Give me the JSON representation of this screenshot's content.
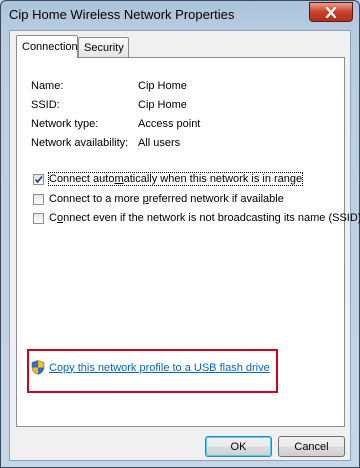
{
  "window": {
    "title": "Cip Home Wireless Network Properties"
  },
  "tabs": [
    {
      "label": "Connection",
      "active": true
    },
    {
      "label": "Security",
      "active": false
    }
  ],
  "info": [
    {
      "label": "Name:",
      "value": "Cip Home"
    },
    {
      "label": "SSID:",
      "value": "Cip Home"
    },
    {
      "label": "Network type:",
      "value": "Access point"
    },
    {
      "label": "Network availability:",
      "value": "All users"
    }
  ],
  "options": [
    {
      "pre": "Connect auto",
      "key": "m",
      "post": "atically when this network is in range",
      "checked": true
    },
    {
      "pre": "Connect to a more ",
      "key": "p",
      "post": "referred network if available",
      "checked": false
    },
    {
      "pre": "C",
      "key": "o",
      "post": "nnect even if the network is not broadcasting its name (SSID)",
      "checked": false
    }
  ],
  "copy_link": {
    "label": "Copy this network profile to a USB flash drive",
    "icon": "uac-shield-icon"
  },
  "buttons": {
    "ok": "OK",
    "cancel": "Cancel"
  },
  "colors": {
    "highlight_border": "#d0001f",
    "link": "#0066cc",
    "close_button": "#c8402a"
  }
}
